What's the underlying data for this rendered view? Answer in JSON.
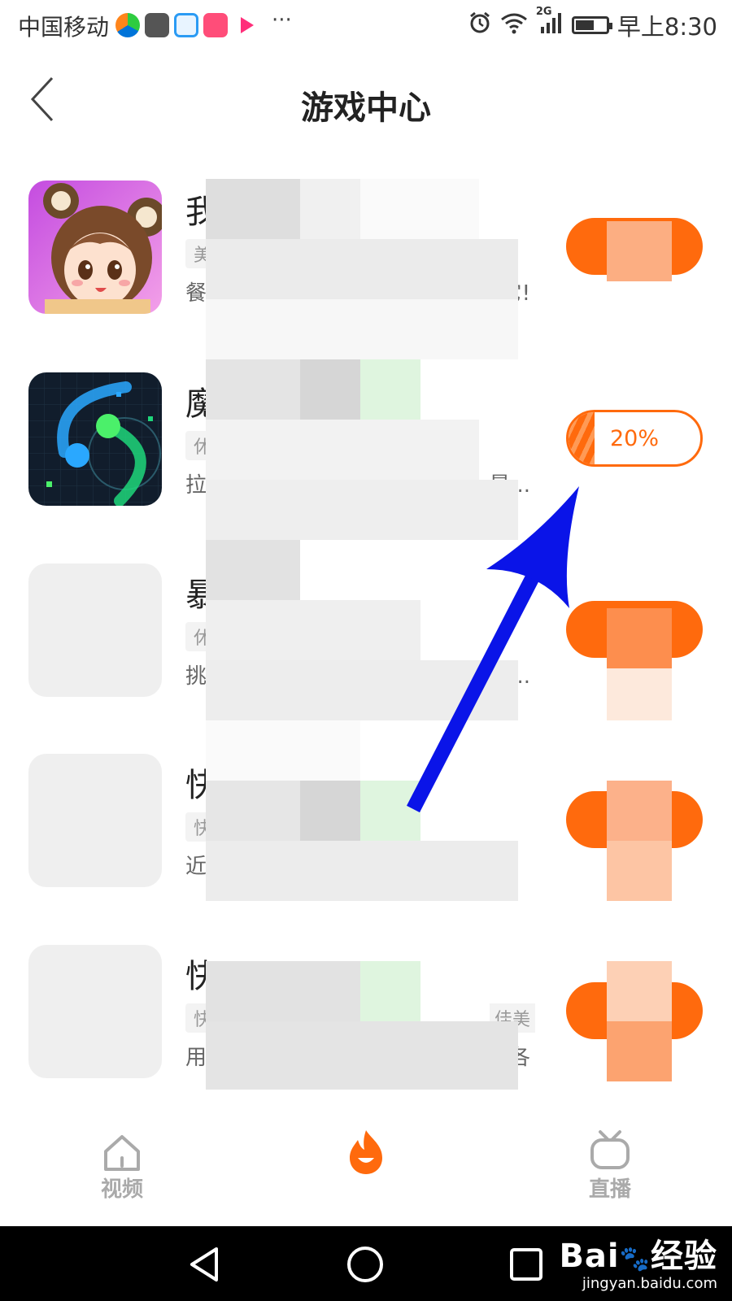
{
  "status_bar": {
    "carrier": "中国移动",
    "network": "2G",
    "time": "早上8:30",
    "dots": "···",
    "battery_level": 0.5,
    "mini_app_icons": [
      "iqiyi-icon",
      "camera-app-icon",
      "browser-app-icon",
      "music-app-icon",
      "youku-icon"
    ]
  },
  "header": {
    "title": "游戏中心"
  },
  "games": [
    {
      "name_visible": "我",
      "tag_visible": "美",
      "desc_visible": "餐",
      "desc_end": "它!",
      "button_state": "obscured"
    },
    {
      "name_visible": "魔",
      "tag_visible": "休",
      "desc_visible": "拉",
      "desc_end": "最...",
      "button_state": "downloading",
      "progress_label": "20%",
      "progress": 0.2
    },
    {
      "name_visible": "暴",
      "tag_visible": "休",
      "desc_visible": "挑",
      "desc_end": "套...",
      "button_state": "obscured"
    },
    {
      "name_visible": "快",
      "tag_visible": "快",
      "desc_visible": "近",
      "desc_end": "",
      "button_state": "obscured"
    },
    {
      "name_visible": "快",
      "tag_visible": "快",
      "desc_visible": "用",
      "desc_end": "各",
      "tag_end": "佳美",
      "button_state": "obscured"
    }
  ],
  "bottom_nav": [
    {
      "label": "视频",
      "icon": "home-icon"
    },
    {
      "label": "",
      "icon": "flame-icon",
      "active": true
    },
    {
      "label": "直播",
      "icon": "tv-icon"
    }
  ],
  "watermark": {
    "brand": "Bai",
    "paw": "🐾",
    "jingyan": "经验",
    "url": "jingyan.baidu.com"
  },
  "colors": {
    "accent": "#ff6a0d",
    "arrow": "#0a14e8"
  }
}
